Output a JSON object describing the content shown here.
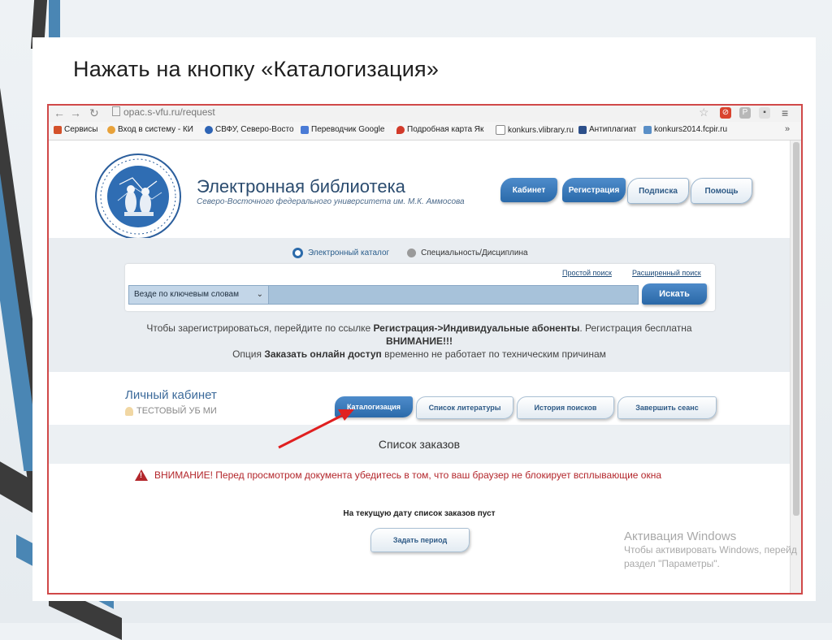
{
  "slide": {
    "title": "Нажать на кнопку «Каталогизация»"
  },
  "browser": {
    "url": "opac.s-vfu.ru/request",
    "bookmarks": [
      {
        "label": "Сервисы",
        "color": "#d4512a"
      },
      {
        "label": "Вход в систему - КИ",
        "color": "#e8a23a"
      },
      {
        "label": "СВФУ, Северо-Восто",
        "color": "#2e64b5"
      },
      {
        "label": "Переводчик Google",
        "color": "#4a7bd6"
      },
      {
        "label": "Подробная карта Як",
        "color": "#d23a2a"
      },
      {
        "label": "konkurs.vlibrary.ru",
        "color": "#888888"
      },
      {
        "label": "Антиплагиат",
        "color": "#2c4f8a"
      },
      {
        "label": "konkurs2014.fcpir.ru",
        "color": "#5a8fc7"
      }
    ]
  },
  "header": {
    "logo_text": "НАУЧНАЯ БИБЛИОТЕКА",
    "title": "Электронная библиотека",
    "subtitle": "Северо-Восточного федерального университета им. М.К. Аммосова",
    "buttons": [
      "Кабинет",
      "Регистрация",
      "Подписка",
      "Помощь"
    ]
  },
  "search": {
    "radio_options": [
      "Электронный каталог",
      "Специальность/Дисциплина"
    ],
    "links": [
      "Простой поиск",
      "Расширенный поиск"
    ],
    "select_value": "Везде по ключевым словам",
    "button": "Искать",
    "notice1_pre": "Чтобы зарегистрироваться, перейдите по ссылке ",
    "notice1_bold": "Регистрация->Индивидуальные абоненты",
    "notice1_post": ". Регистрация бесплатна",
    "notice2": "ВНИМАНИЕ!!!",
    "notice3_pre": "Опция ",
    "notice3_bold": "Заказать онлайн доступ",
    "notice3_post": " временно не работает по техническим причинам"
  },
  "cabinet": {
    "title": "Личный кабинет",
    "user": "ТЕСТОВЫЙ УБ МИ",
    "buttons": [
      "Каталогизация",
      "Список литературы",
      "История поисков",
      "Завершить сеанс"
    ]
  },
  "orders": {
    "title": "Список заказов",
    "warning_bold": "ВНИМАНИЕ!",
    "warning_text": " Перед просмотром документа убедитесь в том, что ваш браузер не блокирует всплывающие окна",
    "empty": "На текущую дату список заказов пуст",
    "period_button": "Задать период"
  },
  "activation": {
    "title": "Активация Windows",
    "line1": "Чтобы активировать Windows, перейд",
    "line2": "раздел \"Параметры\"."
  },
  "colors": {
    "accent_blue": "#2b6aaa",
    "warning_red": "#b3262b",
    "arrow_red": "#e02020"
  }
}
